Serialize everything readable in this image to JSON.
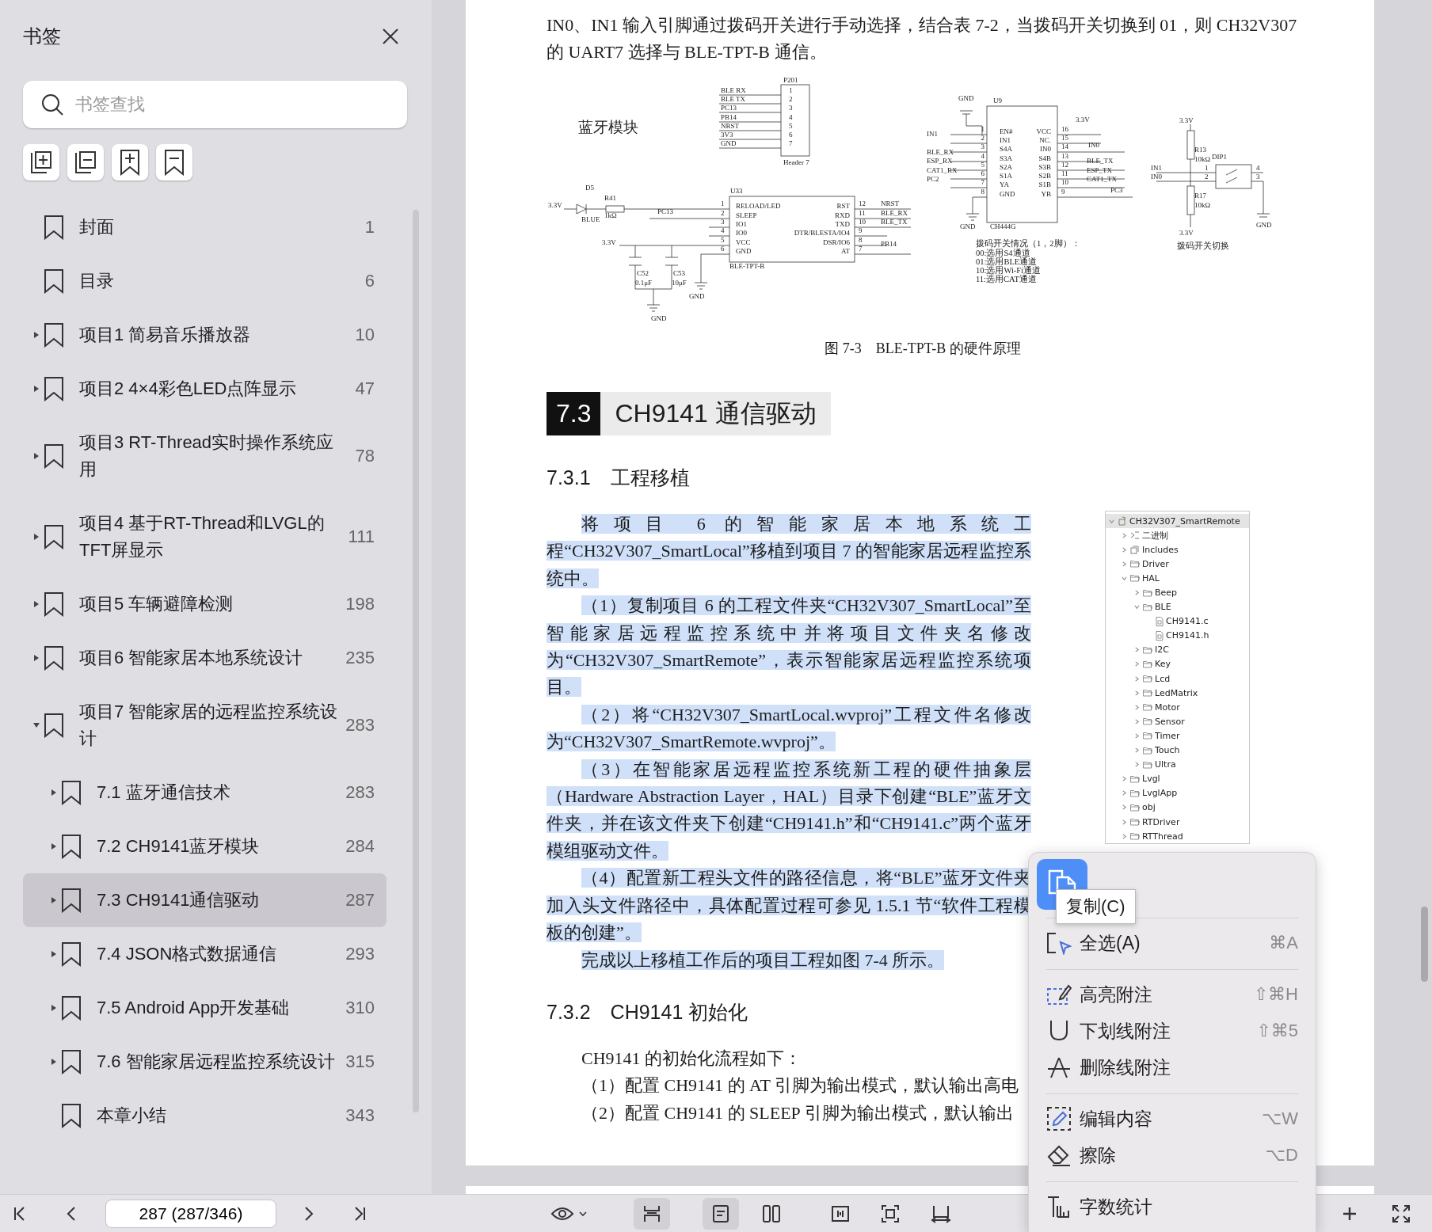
{
  "sidebar": {
    "title": "书签",
    "search": {
      "placeholder": "书签查找"
    },
    "tool_buttons": [
      {
        "kind": "expand"
      },
      {
        "kind": "collapse"
      },
      {
        "kind": "add"
      },
      {
        "kind": "remove"
      }
    ],
    "bookmarks": [
      {
        "title": "封面",
        "page": "1",
        "kind": "leaf",
        "selected": false
      },
      {
        "title": "目录",
        "page": "6",
        "kind": "leaf",
        "selected": false
      },
      {
        "title": "项目1 简易音乐播放器",
        "page": "10",
        "kind": "branch",
        "expanded": false,
        "selected": false
      },
      {
        "title": "项目2 4×4彩色LED点阵显示",
        "page": "47",
        "kind": "branch",
        "expanded": false,
        "selected": false
      },
      {
        "title": "项目3 RT-Thread实时操作系统应用",
        "page": "78",
        "kind": "branch",
        "expanded": false,
        "selected": false
      },
      {
        "title": "项目4 基于RT-Thread和LVGL的TFT屏显示",
        "page": "111",
        "kind": "branch",
        "expanded": false,
        "selected": false
      },
      {
        "title": "项目5 车辆避障检测",
        "page": "198",
        "kind": "branch",
        "expanded": false,
        "selected": false
      },
      {
        "title": "项目6 智能家居本地系统设计",
        "page": "235",
        "kind": "branch",
        "expanded": false,
        "selected": false
      },
      {
        "title": "项目7 智能家居的远程监控系统设计",
        "page": "283",
        "kind": "branch",
        "expanded": true,
        "selected": false,
        "children": [
          {
            "title": "7.1 蓝牙通信技术",
            "page": "283",
            "kind": "branch",
            "expanded": false,
            "selected": false
          },
          {
            "title": "7.2 CH9141蓝牙模块",
            "page": "284",
            "kind": "branch",
            "expanded": false,
            "selected": false
          },
          {
            "title": "7.3 CH9141通信驱动",
            "page": "287",
            "kind": "branch",
            "expanded": false,
            "selected": true
          },
          {
            "title": "7.4 JSON格式数据通信",
            "page": "293",
            "kind": "branch",
            "expanded": false,
            "selected": false
          },
          {
            "title": "7.5 Android App开发基础",
            "page": "310",
            "kind": "branch",
            "expanded": false,
            "selected": false
          },
          {
            "title": "7.6 智能家居远程监控系统设计",
            "page": "315",
            "kind": "branch",
            "expanded": false,
            "selected": false
          },
          {
            "title": "本章小结",
            "page": "343",
            "kind": "leaf",
            "selected": false
          }
        ]
      }
    ]
  },
  "document": {
    "top_lines": [
      "IN0、IN1 输入引脚通过拨码开关进行手动选择，结合表 7-2，当拨码开关切换到 01，则 CH32V307",
      "的 UART7 选择与 BLE-TPT-B 通信。"
    ],
    "schematic": {
      "title": "蓝牙模块",
      "labels": [
        "P201",
        "BLE RX",
        "BLE TX",
        "PC13",
        "PB14",
        "NRST",
        "3V3",
        "GND",
        "1",
        "2",
        "3",
        "4",
        "5",
        "6",
        "7",
        "Header 7",
        "D5",
        "R41",
        "3.3V",
        "BLUE",
        "1kΩ",
        "PC13",
        "U33",
        "RELOAD/LED",
        "SLEEP",
        "IO1",
        "IO0",
        "VCC",
        "GND",
        "1",
        "2",
        "3",
        "4",
        "5",
        "6",
        "RST",
        "RXD",
        "TXD",
        "DTR/BLESTA/IO4",
        "DSR/IO6",
        "AT",
        "12",
        "11",
        "10",
        "9",
        "8",
        "7",
        "NRST",
        "BLE_RX",
        "BLE_TX",
        "PB14",
        "BLE-TPT-B",
        "3.3V",
        "C52",
        "0.1μF",
        "C53",
        "10μF",
        "GND",
        "GND",
        "GND",
        "U9",
        "EN#",
        "IN1",
        "S4A",
        "S3A",
        "S2A",
        "S1A",
        "YA",
        "GND",
        "1",
        "2",
        "3",
        "4",
        "5",
        "6",
        "7",
        "8",
        "IN1",
        "BLE_RX",
        "ESP_RX",
        "CAT1_RX",
        "PC2",
        "VCC",
        "NC.",
        "IN0",
        "S4B",
        "S3B",
        "S2B",
        "S1B",
        "YB",
        "16",
        "15",
        "14",
        "13",
        "12",
        "11",
        "10",
        "9",
        "3.3V",
        "IN0",
        "BLE_TX",
        "ESP_TX",
        "CAT1_TX",
        "PC3",
        "GND",
        "CH444G",
        "拨码开关情况（1，2脚）：",
        "00:选用S4通道",
        "01:选用BLE通道",
        "10:选用Wi-Fi通道",
        "11:选用CAT通道",
        "3.3V",
        "R13",
        "10kΩ",
        "DIP1",
        "IN1",
        "IN0",
        "1",
        "2",
        "4",
        "3",
        "R17",
        "10kΩ",
        "GND",
        "3.3V",
        "拨码开关切换"
      ]
    },
    "figure_caption": "图 7-3　BLE-TPT-B 的硬件原理",
    "section": {
      "number": "7.3",
      "title": "CH9141 通信驱动"
    },
    "subsections": [
      {
        "number": "7.3.1",
        "title": "工程移植",
        "paragraphs": [
          {
            "text": "将项目 6 的智能家居本地系统工程“CH32V307_SmartLocal”移植到项目 7 的智能家居远程监控系统中。",
            "selected": true
          },
          {
            "text": "（1）复制项目 6 的工程文件夹“CH32V307_SmartLocal”至智能家居远程监控系统中并将项目文件夹名修改为“CH32V307_SmartRemote”，表示智能家居远程监控系统项目。",
            "selected": true
          },
          {
            "text": "（2）将“CH32V307_SmartLocal.wvproj”工程文件名修改为“CH32V307_SmartRemote.wvproj”。",
            "selected": true
          },
          {
            "text": "（3）在智能家居远程监控系统新工程的硬件抽象层（Hardware Abstraction Layer，HAL）目录下创建“BLE”蓝牙文件夹，并在该文件夹下创建“CH9141.h”和“CH9141.c”两个蓝牙模组驱动文件。",
            "selected": true
          },
          {
            "text": "（4）配置新工程头文件的路径信息，将“BLE”蓝牙文件夹加入头文件路径中，具体配置过程可参见 1.5.1 节“软件工程模板的创建”。",
            "selected": true
          },
          {
            "text": "完成以上移植工作后的项目工程如图 7-4 所示。",
            "selected": true
          }
        ],
        "figure": {
          "name": "CH32V307_SmartRemote",
          "kind": "project",
          "expanded": true,
          "selected": true,
          "children": [
            {
              "name": "二进制",
              "kind": "binaries",
              "expanded": false,
              "selected": false
            },
            {
              "name": "Includes",
              "kind": "includes",
              "expanded": false,
              "selected": false
            },
            {
              "name": "Driver",
              "kind": "folder",
              "expanded": false,
              "selected": false
            },
            {
              "name": "HAL",
              "kind": "folder",
              "expanded": true,
              "selected": false,
              "children": [
                {
                  "name": "Beep",
                  "kind": "folder",
                  "expanded": false,
                  "selected": false
                },
                {
                  "name": "BLE",
                  "kind": "folder",
                  "expanded": true,
                  "selected": false,
                  "children": [
                    {
                      "name": "CH9141.c",
                      "kind": "file",
                      "selected": false
                    },
                    {
                      "name": "CH9141.h",
                      "kind": "file",
                      "selected": false
                    }
                  ]
                },
                {
                  "name": "I2C",
                  "kind": "folder",
                  "expanded": false,
                  "selected": false
                },
                {
                  "name": "Key",
                  "kind": "folder",
                  "expanded": false,
                  "selected": false
                },
                {
                  "name": "Lcd",
                  "kind": "folder",
                  "expanded": false,
                  "selected": false
                },
                {
                  "name": "LedMatrix",
                  "kind": "folder",
                  "expanded": false,
                  "selected": false
                },
                {
                  "name": "Motor",
                  "kind": "folder",
                  "expanded": false,
                  "selected": false
                },
                {
                  "name": "Sensor",
                  "kind": "folder",
                  "expanded": false,
                  "selected": false
                },
                {
                  "name": "Timer",
                  "kind": "folder",
                  "expanded": false,
                  "selected": false
                },
                {
                  "name": "Touch",
                  "kind": "folder",
                  "expanded": false,
                  "selected": false
                },
                {
                  "name": "Ultra",
                  "kind": "folder",
                  "expanded": false,
                  "selected": false
                }
              ]
            },
            {
              "name": "Lvgl",
              "kind": "folder",
              "expanded": false,
              "selected": false
            },
            {
              "name": "LvglApp",
              "kind": "folder",
              "expanded": false,
              "selected": false
            },
            {
              "name": "obj",
              "kind": "folder",
              "expanded": false,
              "selected": false
            },
            {
              "name": "RTDriver",
              "kind": "folder",
              "expanded": false,
              "selected": false
            },
            {
              "name": "RTThread",
              "kind": "folder",
              "expanded": false,
              "selected": false
            }
          ]
        }
      },
      {
        "number": "7.3.2",
        "title": "CH9141 初始化",
        "paragraphs": [
          {
            "text": "CH9141 的初始化流程如下：",
            "selected": false
          },
          {
            "text": "（1）配置 CH9141 的 AT 引脚为输出模式，默认输出高电",
            "selected": false
          },
          {
            "text": "（2）配置 CH9141 的 SLEEP 引脚为输出模式，默认输出",
            "selected": false
          }
        ]
      }
    ]
  },
  "toolbar": {
    "page_field": "287 (287/346)",
    "view_buttons": [
      {
        "kind": "scroll",
        "selected": true
      },
      {
        "kind": "single",
        "selected": true
      },
      {
        "kind": "double",
        "selected": false
      },
      {
        "kind": "split",
        "selected": false
      },
      {
        "kind": "fit",
        "selected": false
      },
      {
        "kind": "width",
        "selected": false
      }
    ]
  },
  "context_menu": {
    "copy_tooltip": "复制(C)",
    "sections": [
      [
        {
          "kind": "select",
          "label": "全选(A)",
          "shortcut": "⌘A"
        }
      ],
      [
        {
          "kind": "highlight",
          "label": "高亮附注",
          "shortcut": "⇧⌘H"
        },
        {
          "kind": "underline",
          "label": "下划线附注",
          "shortcut": "⇧⌘5"
        },
        {
          "kind": "strike",
          "label": "删除线附注"
        }
      ],
      [
        {
          "kind": "edit",
          "label": "编辑内容",
          "shortcut": "⌥W"
        },
        {
          "kind": "erase",
          "label": "擦除",
          "shortcut": "⌥D"
        }
      ],
      [
        {
          "kind": "count",
          "label": "字数统计"
        }
      ]
    ]
  }
}
